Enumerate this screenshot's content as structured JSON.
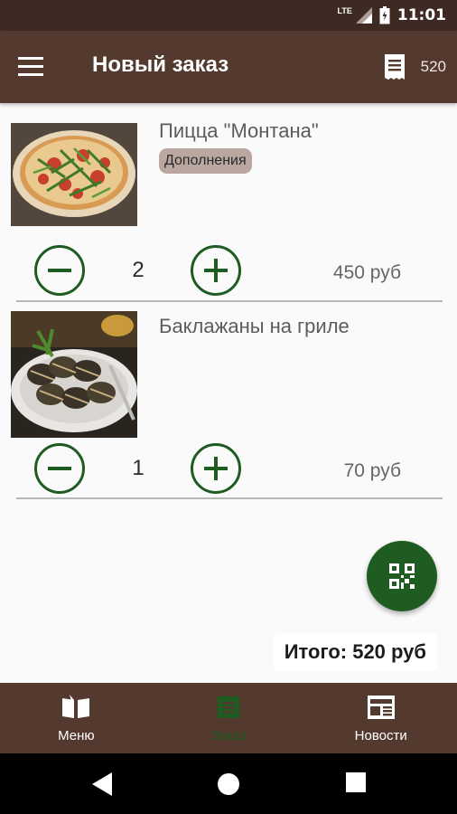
{
  "status_bar": {
    "network": "LTE",
    "time": "11:01"
  },
  "app_bar": {
    "title": "Новый заказ",
    "order_count": "520"
  },
  "order": {
    "items": [
      {
        "name": "Пицца \"Монтана\"",
        "addon_label": "Дополнения",
        "quantity": "2",
        "price": "450 руб"
      },
      {
        "name": "Баклажаны на гриле",
        "quantity": "1",
        "price": "70 руб"
      }
    ]
  },
  "total": "Итого: 520 руб",
  "bottom_nav": {
    "items": [
      {
        "label": "Меню",
        "icon": "book-icon",
        "active": false
      },
      {
        "label": "Заказ",
        "icon": "receipt-icon",
        "active": true
      },
      {
        "label": "Новости",
        "icon": "newspaper-icon",
        "active": false
      }
    ]
  },
  "colors": {
    "app_bar": "#543a2e",
    "status_bar": "#3e2a22",
    "accent_green": "#1e5c22",
    "chip": "#b9a7a0"
  }
}
